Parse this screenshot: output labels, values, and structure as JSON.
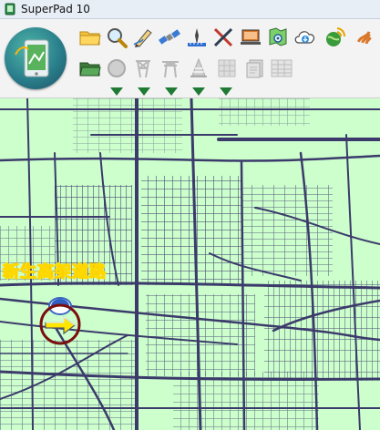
{
  "window": {
    "title": "SuperPad 10"
  },
  "toolbar": {
    "row1": [
      {
        "name": "open-folder-icon"
      },
      {
        "name": "search-icon"
      },
      {
        "name": "pen-edit-icon"
      },
      {
        "name": "satellite-icon"
      },
      {
        "name": "measure-icon"
      },
      {
        "name": "tools-icon"
      },
      {
        "name": "laptop-icon"
      },
      {
        "name": "map-view-icon"
      },
      {
        "name": "cloud-download-icon"
      },
      {
        "name": "earth-signal-icon"
      },
      {
        "name": "sound-icon"
      }
    ],
    "row2": [
      {
        "name": "folder-green-icon",
        "enabled": true
      },
      {
        "name": "record-circle-icon",
        "enabled": false
      },
      {
        "name": "tower-icon",
        "enabled": false
      },
      {
        "name": "power-pylon-icon",
        "enabled": false
      },
      {
        "name": "cone-icon",
        "enabled": false
      },
      {
        "name": "grid-layer-icon",
        "enabled": false
      },
      {
        "name": "document-icon",
        "enabled": false
      },
      {
        "name": "table-icon",
        "enabled": false
      }
    ],
    "dropdown_count": 5
  },
  "map": {
    "road_label": "新生高架道路",
    "background_color": "#ccffcc",
    "road_color": "#3b3a6b"
  }
}
